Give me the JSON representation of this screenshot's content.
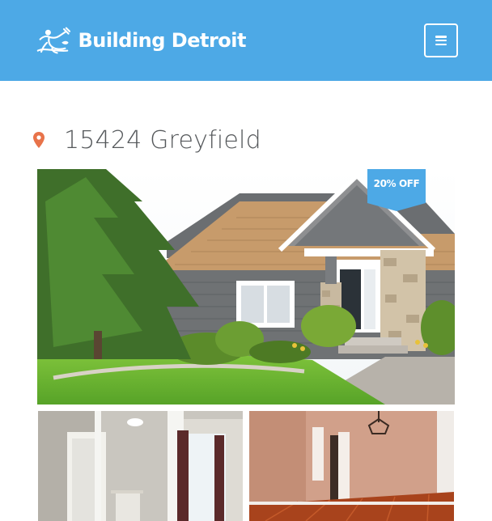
{
  "site": {
    "brand": "Building Detroit",
    "accent_color": "#4da9e6",
    "logo_icon": "spirit-of-detroit-icon",
    "menu_icon": "hamburger-menu-icon"
  },
  "listing": {
    "address": "15424 Greyfield",
    "location_icon": "map-marker-icon",
    "pin_color": "#e8734a",
    "badge": "20% OFF"
  },
  "photos": {
    "main": "house-exterior-photo",
    "thumbnails": [
      "interior-doorway-photo",
      "interior-living-room-photo"
    ]
  }
}
